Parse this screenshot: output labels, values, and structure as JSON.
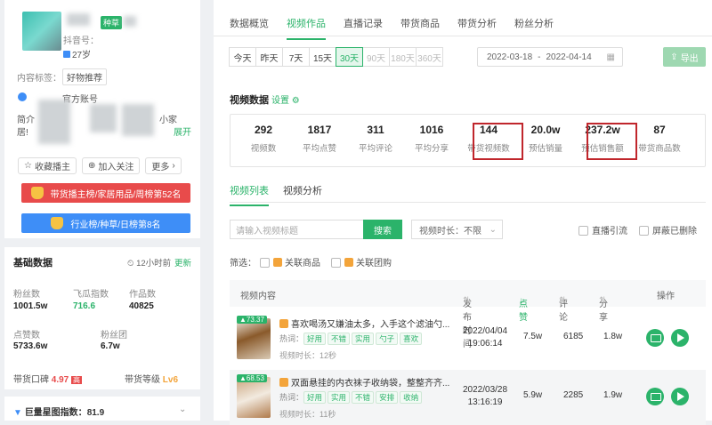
{
  "left": {
    "profile": {
      "tag": "种草",
      "age": "27岁",
      "id_prefix": "抖音号：",
      "official": "官方账号",
      "intro_prefix": "简介",
      "intro_line2": "居!",
      "intro_more": "展开",
      "intro_mid": "小家"
    },
    "content_tags_label": "内容标签：",
    "content_tag": "好物推荐",
    "actions": {
      "favorite": "收藏播主",
      "follow": "加入关注",
      "more": "更多"
    },
    "ranks": [
      "带货播主榜/家居用品/周榜第52名",
      "行业榜/种草/日榜第8名"
    ],
    "basic": {
      "title": "基础数据",
      "refresh_time": "12小时前",
      "refresh": "更新",
      "stats": [
        {
          "label": "粉丝数",
          "value": "1001.5w"
        },
        {
          "label": "飞瓜指数",
          "value": "716.6"
        },
        {
          "label": "作品数",
          "value": "40825"
        },
        {
          "label": "点赞数",
          "value": "5733.6w"
        },
        {
          "label": "粉丝团",
          "value": "6.7w"
        }
      ],
      "reputation_label": "带货口碑",
      "reputation_value": "4.97",
      "reputation_badge": "高",
      "level_label": "带货等级",
      "level_value": "Lv6",
      "index_label": "巨量星图指数：",
      "index_value": "81.9"
    }
  },
  "tabs": [
    "数据概览",
    "视频作品",
    "直播记录",
    "带货商品",
    "带货分析",
    "粉丝分析"
  ],
  "day_filters": [
    {
      "label": "今天",
      "state": "normal"
    },
    {
      "label": "昨天",
      "state": "normal"
    },
    {
      "label": "7天",
      "state": "normal"
    },
    {
      "label": "15天",
      "state": "normal"
    },
    {
      "label": "30天",
      "state": "on"
    },
    {
      "label": "90天",
      "state": "dis"
    },
    {
      "label": "180天",
      "state": "dis"
    },
    {
      "label": "360天",
      "state": "dis"
    }
  ],
  "date_start": "2022-03-18",
  "date_sep": "-",
  "date_end": "2022-04-14",
  "export_label": "导出",
  "video_data": {
    "title": "视频数据",
    "settings": "设置",
    "metrics": [
      {
        "value": "292",
        "label": "视频数"
      },
      {
        "value": "1817",
        "label": "平均点赞"
      },
      {
        "value": "311",
        "label": "平均评论"
      },
      {
        "value": "1016",
        "label": "平均分享"
      },
      {
        "value": "144",
        "label": "带货视频数"
      },
      {
        "value": "20.0w",
        "label": "预估销量"
      },
      {
        "value": "237.2w",
        "label": "预估销售额"
      },
      {
        "value": "87",
        "label": "带货商品数"
      }
    ]
  },
  "subtabs": [
    "视频列表",
    "视频分析"
  ],
  "search": {
    "placeholder": "请输入视频标题",
    "button": "搜索",
    "duration": "视频时长：不限"
  },
  "options": {
    "live": "直播引流",
    "block_deleted": "屏蔽已删除",
    "filter_label": "筛选：",
    "product": "关联商品",
    "group": "关联团购"
  },
  "table": {
    "headers": [
      "视频内容",
      "发布时间",
      "点赞",
      "评论",
      "分享",
      "操作"
    ],
    "hot_label": "热词：",
    "dur_label": "视频时长：",
    "rows": [
      {
        "score": "73.37",
        "title": "喜欢喝汤又嫌油太多，入手这个滤油勺...",
        "tags": [
          "好用",
          "不错",
          "实用",
          "勺子",
          "喜欢"
        ],
        "duration": "12秒",
        "date": "2022/04/04",
        "time": "19:06:14",
        "likes": "7.5w",
        "comments": "6185",
        "shares": "1.8w"
      },
      {
        "score": "68.53",
        "title": "双面悬挂的内衣袜子收纳袋，整整齐齐...",
        "tags": [
          "好用",
          "实用",
          "不错",
          "安排",
          "收纳"
        ],
        "duration": "11秒",
        "date": "2022/03/28",
        "time": "13:16:19",
        "likes": "5.9w",
        "comments": "2285",
        "shares": "1.9w"
      }
    ]
  },
  "colors": {
    "accent": "#2bb36a",
    "highlight": "#c0262c",
    "rank1": "#e84b4b",
    "rank2": "#3e8ef7"
  }
}
